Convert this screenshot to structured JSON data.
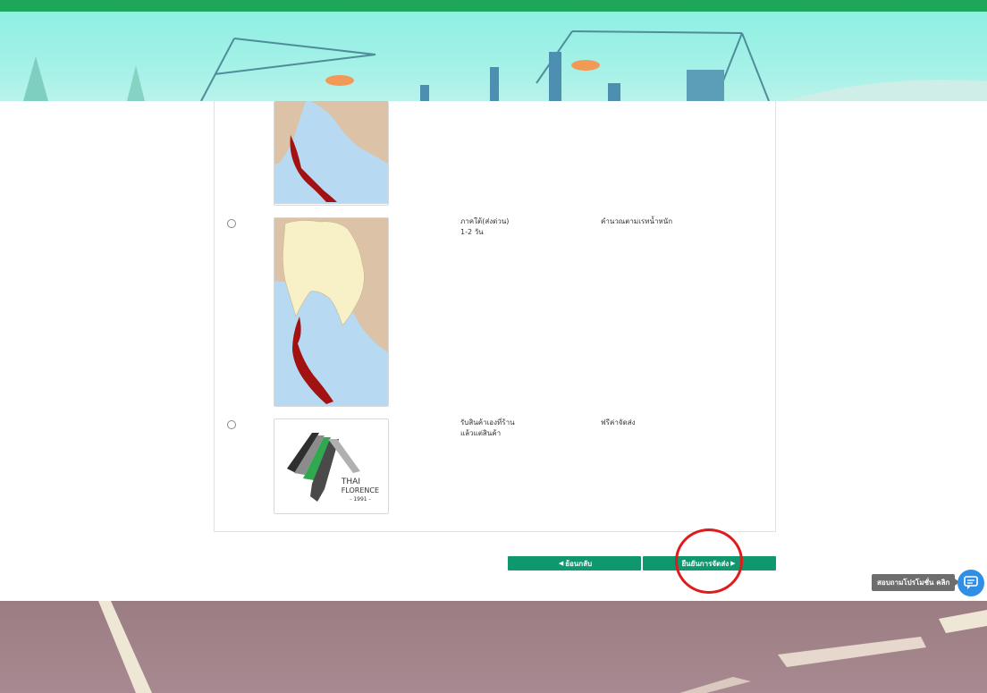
{
  "colors": {
    "topbar": "#1ea65a",
    "button": "#0f9770",
    "highlight": "#e01b1b",
    "chat": "#2f8fe6"
  },
  "shipping_options": [
    {
      "id": "south-express",
      "title": "ภาคใต้(ส่งด่วน)",
      "subtitle": "1-2 วัน",
      "price": "คำนวณตามเรทน้ำหนัก",
      "image": "thailand-south-region-map"
    },
    {
      "id": "store-pickup",
      "title": "รับสินค้าเองที่ร้าน",
      "subtitle": "แล้วแต่สินค้า",
      "price": "ฟรีค่าจัดส่ง",
      "image": "thai-florence-logo"
    }
  ],
  "logo": {
    "line1": "THAI",
    "line2": "FLORENCE",
    "line3": "- 1991 -"
  },
  "buttons": {
    "back": "ย้อนกลับ",
    "confirm": "ยืนยันการจัดส่ง"
  },
  "help": {
    "label": "สอบถามโปรโมชั่น คลิก",
    "icon": "chat-icon"
  }
}
